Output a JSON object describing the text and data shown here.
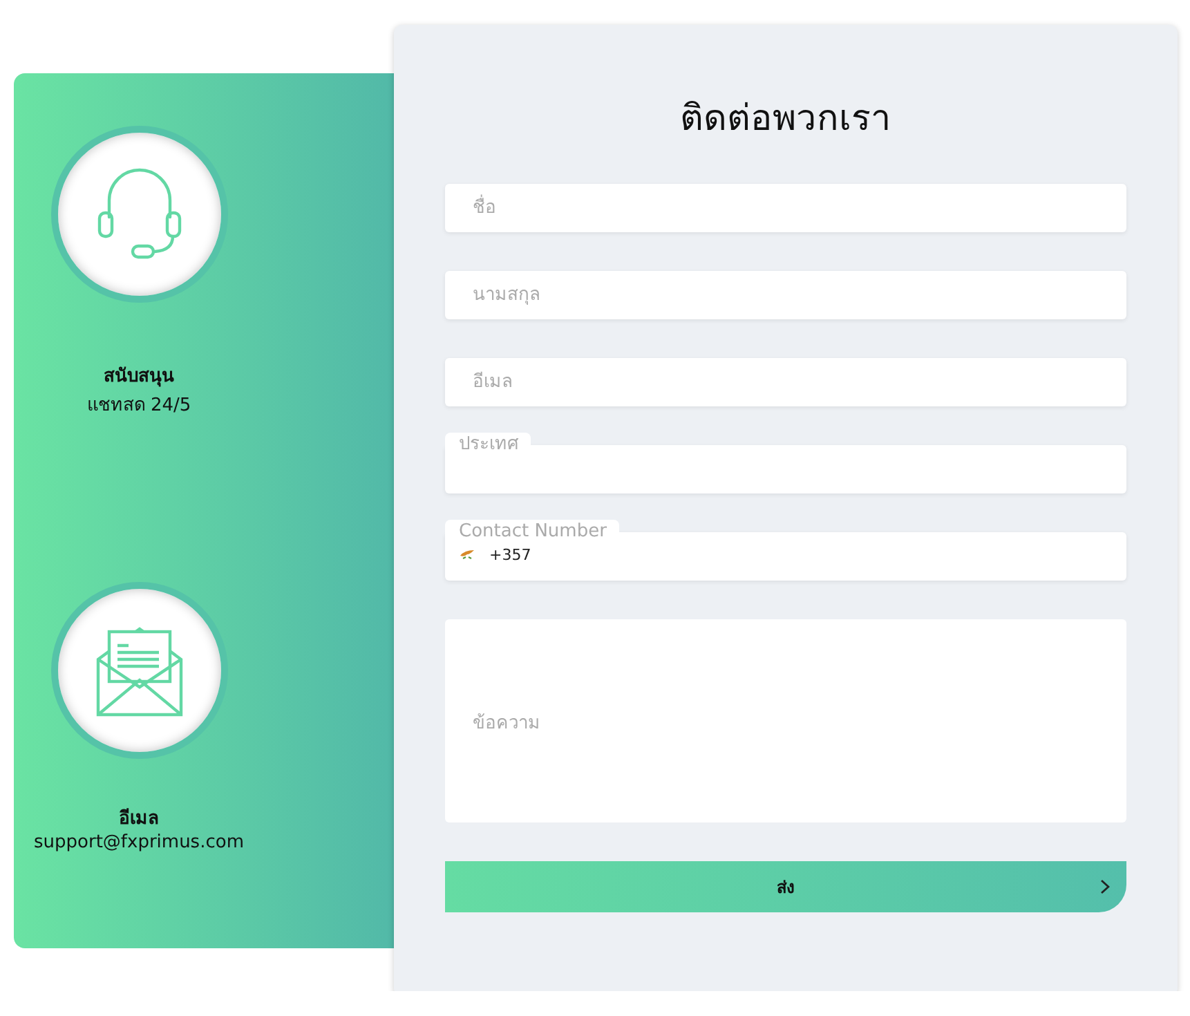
{
  "contacts": [
    {
      "kind": "headset",
      "title": "สนับสนุน",
      "detail": "แชทสด 24/5"
    },
    {
      "kind": "mail",
      "title": "อีเมล",
      "detail": "support@fxprimus.com"
    }
  ],
  "form": {
    "title": "ติดต่อพวกเรา",
    "fields": [
      {
        "kind": "text",
        "placeholder": "ชื่อ"
      },
      {
        "kind": "text",
        "placeholder": "นามสกุล"
      },
      {
        "kind": "text",
        "placeholder": "อีเมล"
      },
      {
        "kind": "select",
        "label": "ประเทศ"
      },
      {
        "kind": "phone",
        "label": "Contact Number",
        "value": "+357"
      },
      {
        "kind": "textarea",
        "placeholder": "ข้อความ"
      }
    ],
    "submit": {
      "label": "ส่ง"
    }
  }
}
